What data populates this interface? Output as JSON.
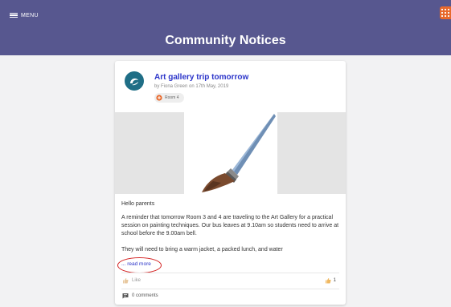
{
  "topbar": {
    "menu_label": "MENU",
    "page_title": "Community Notices",
    "background": "#57578f",
    "app_icon_color": "#e8692c"
  },
  "post": {
    "title": "Art gallery trip tomorrow",
    "meta": "by Fiona Green on 17th May, 2019",
    "tag": "Room 4",
    "greeting": "Hello parents",
    "paragraph1": "A reminder that tomorrow Room 3 and 4 are traveling to the Art Gallery for a practical session on painting techniques. Our bus leaves at 9.10am so students need to arrive at school before the 9.00am bell.",
    "paragraph2": "They will need to bring a warm jacket, a packed lunch, and water",
    "read_more": "... read more",
    "like_label": "Like",
    "like_count": "1",
    "comments_label": "0 comments",
    "title_color": "#2b34c9",
    "annotation_color": "#d32020"
  }
}
